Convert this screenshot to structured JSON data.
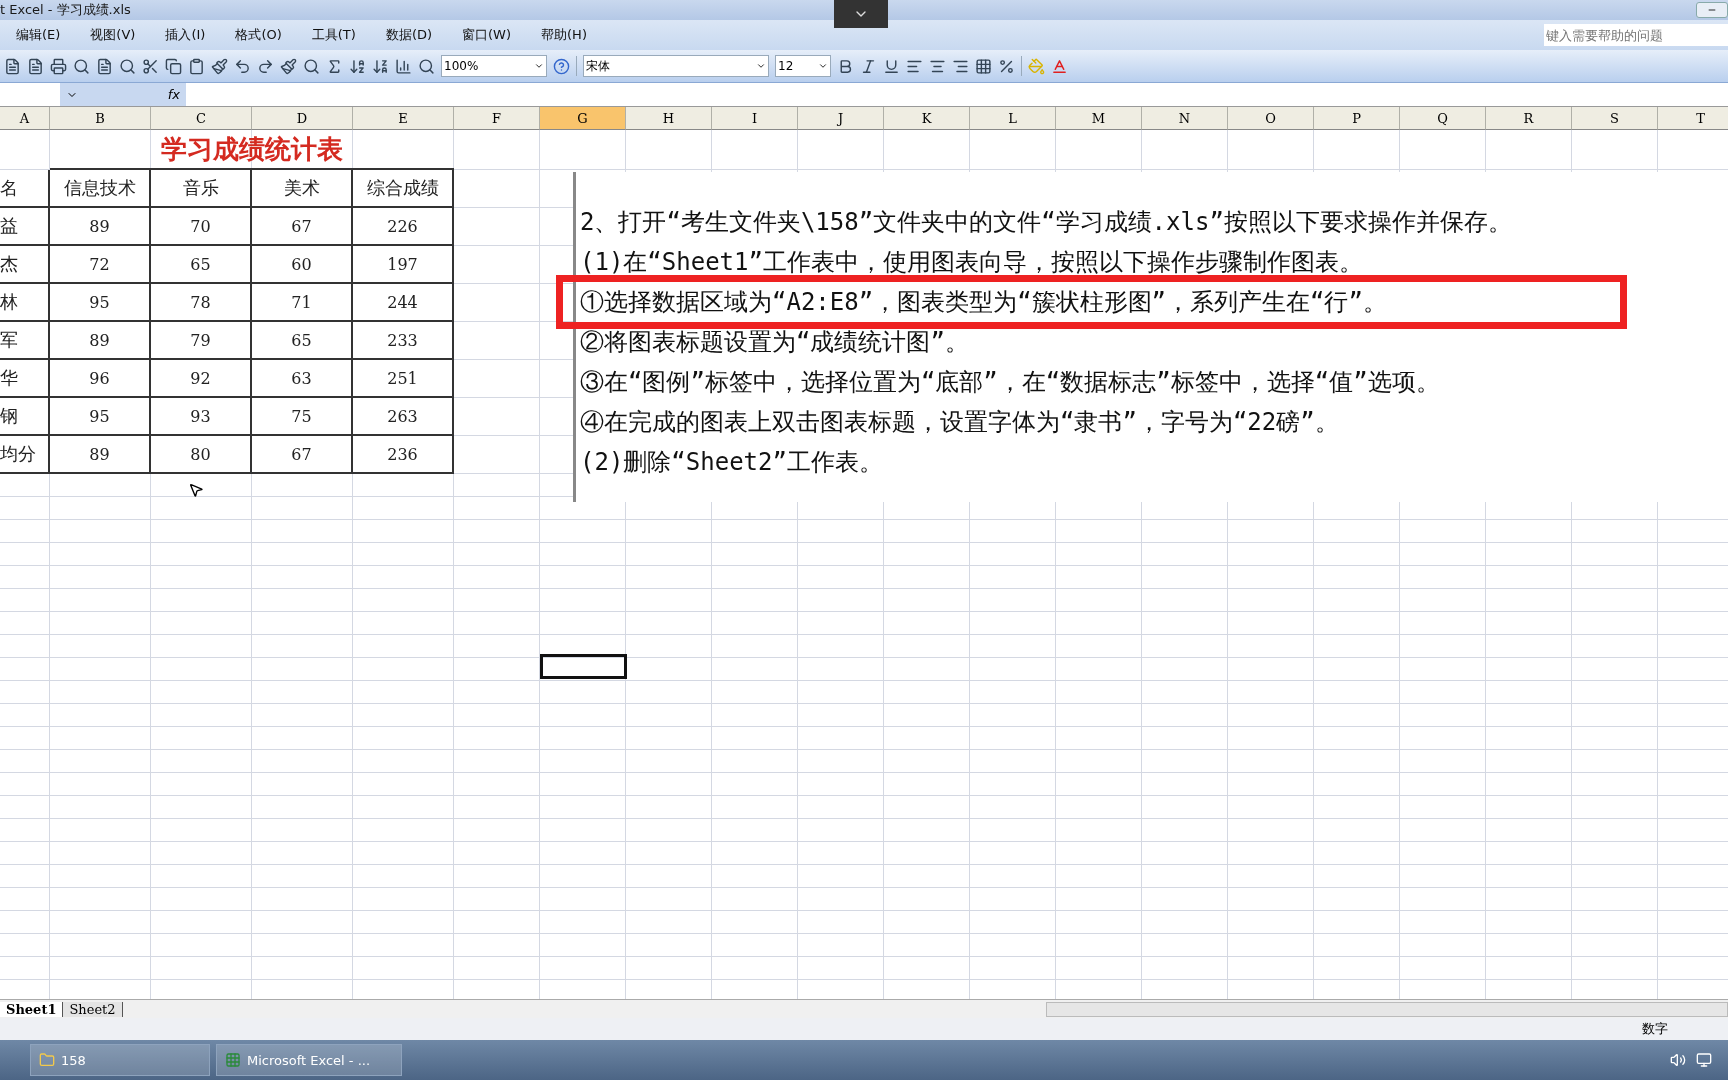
{
  "window": {
    "title": "t Excel - 学习成绩.xls"
  },
  "menu": [
    "编辑(E)",
    "视图(V)",
    "插入(I)",
    "格式(O)",
    "工具(T)",
    "数据(D)",
    "窗口(W)",
    "帮助(H)"
  ],
  "help_box": {
    "placeholder": "键入需要帮助的问题"
  },
  "toolbar": {
    "zoom": "100%",
    "font": "宋体",
    "font_size": "12"
  },
  "formula_bar": {
    "fx": "fx"
  },
  "columns": [
    {
      "label": "A",
      "selected": false
    },
    {
      "label": "B",
      "selected": false
    },
    {
      "label": "C",
      "selected": false
    },
    {
      "label": "D",
      "selected": false
    },
    {
      "label": "E",
      "selected": false
    },
    {
      "label": "F",
      "selected": false
    },
    {
      "label": "G",
      "selected": true
    },
    {
      "label": "H",
      "selected": false
    },
    {
      "label": "I",
      "selected": false
    },
    {
      "label": "J",
      "selected": false
    },
    {
      "label": "K",
      "selected": false
    },
    {
      "label": "L",
      "selected": false
    },
    {
      "label": "M",
      "selected": false
    },
    {
      "label": "N",
      "selected": false
    },
    {
      "label": "O",
      "selected": false
    },
    {
      "label": "P",
      "selected": false
    },
    {
      "label": "Q",
      "selected": false
    },
    {
      "label": "R",
      "selected": false
    },
    {
      "label": "S",
      "selected": false
    },
    {
      "label": "T",
      "selected": false
    }
  ],
  "sheet_title": "学习成绩统计表",
  "table": {
    "header": [
      "名",
      "信息技术",
      "音乐",
      "美术",
      "综合成绩"
    ],
    "rows": [
      [
        "益",
        "89",
        "70",
        "67",
        "226"
      ],
      [
        "杰",
        "72",
        "65",
        "60",
        "197"
      ],
      [
        "林",
        "95",
        "78",
        "71",
        "244"
      ],
      [
        "军",
        "89",
        "79",
        "65",
        "233"
      ],
      [
        "华",
        "96",
        "92",
        "63",
        "251"
      ],
      [
        "钢",
        "95",
        "93",
        "75",
        "263"
      ],
      [
        "均分",
        "89",
        "80",
        "67",
        "236"
      ]
    ]
  },
  "text_box": {
    "lines": [
      {
        "text": "2、打开“考生文件夹\\158”文件夹中的文件“学习成绩.xls”按照以下要求操作并保存。",
        "highlighted": false
      },
      {
        "text": "(1)在“Sheet1”工作表中，使用图表向导，按照以下操作步骤制作图表。",
        "highlighted": false
      },
      {
        "text": "①选择数据区域为“A2:E8”，图表类型为“簇状柱形图”，系列产生在“行”。",
        "highlighted": true
      },
      {
        "text": "②将图表标题设置为“成绩统计图”。",
        "highlighted": false
      },
      {
        "text": "③在“图例”标签中，选择位置为“底部”，在“数据标志”标签中，选择“值”选项。",
        "highlighted": false
      },
      {
        "text": "④在完成的图表上双击图表标题，设置字体为“隶书”，字号为“22磅”。",
        "highlighted": false
      },
      {
        "text": "(2)删除“Sheet2”工作表。",
        "highlighted": false
      }
    ]
  },
  "sheet_tabs": [
    {
      "label": "Sheet1",
      "selected": true
    },
    {
      "label": "Sheet2",
      "selected": false
    }
  ],
  "status_bar": {
    "mode": "数字"
  },
  "taskbar": [
    {
      "label": "158",
      "kind": "folder"
    },
    {
      "label": "Microsoft Excel - ...",
      "kind": "excel"
    }
  ]
}
